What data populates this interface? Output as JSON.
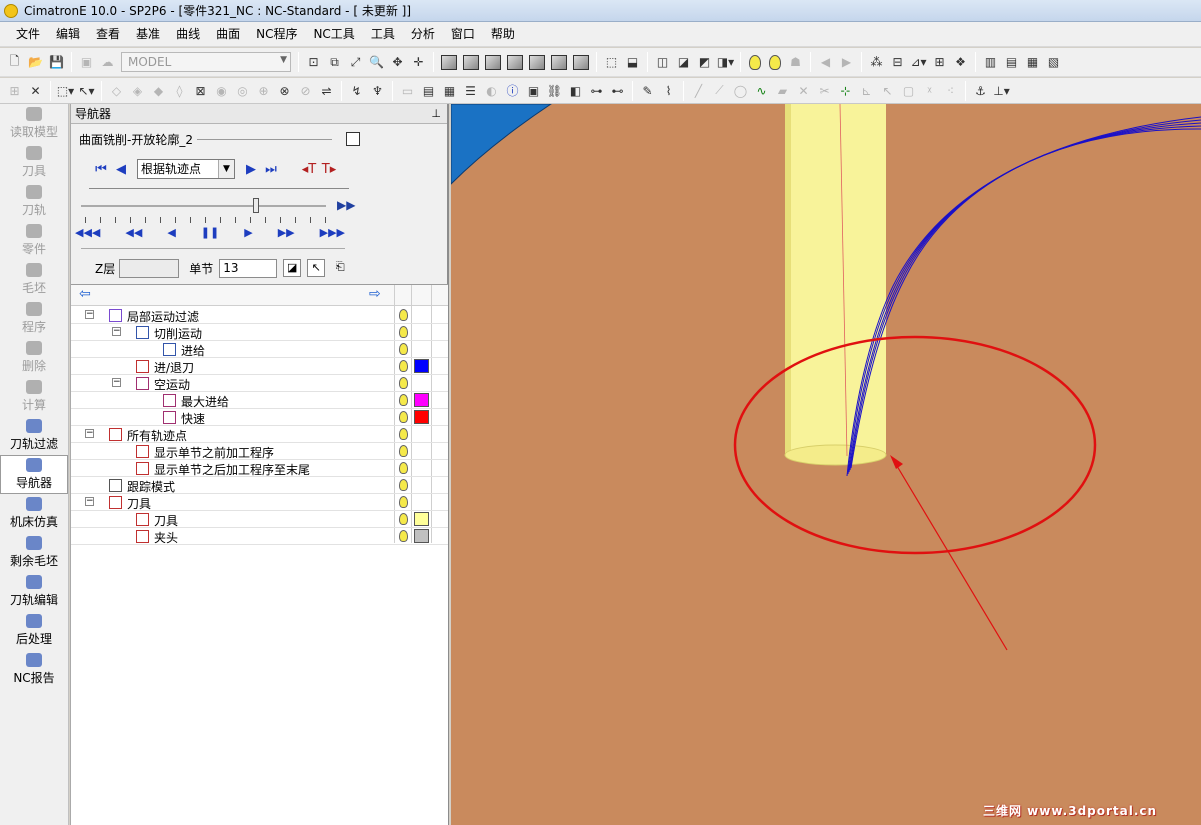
{
  "window": {
    "title": "CimatronE 10.0 - SP2P6 - [零件321_NC : NC-Standard - [ 未更新 ]]"
  },
  "menu": [
    "文件",
    "编辑",
    "查看",
    "基准",
    "曲线",
    "曲面",
    "NC程序",
    "NC工具",
    "工具",
    "分析",
    "窗口",
    "帮助"
  ],
  "toolbar": {
    "model_combo": "MODEL"
  },
  "left_toolbar": [
    {
      "label": "读取模型",
      "enabled": false
    },
    {
      "label": "刀具",
      "enabled": false
    },
    {
      "label": "刀轨",
      "enabled": false
    },
    {
      "label": "零件",
      "enabled": false
    },
    {
      "label": "毛坯",
      "enabled": false
    },
    {
      "label": "程序",
      "enabled": false
    },
    {
      "label": "删除",
      "enabled": false
    },
    {
      "label": "计算",
      "enabled": false
    },
    {
      "label": "刀轨过滤",
      "enabled": true
    },
    {
      "label": "导航器",
      "enabled": true,
      "active": true
    },
    {
      "label": "机床仿真",
      "enabled": true
    },
    {
      "label": "剩余毛坯",
      "enabled": true
    },
    {
      "label": "刀轨编辑",
      "enabled": true
    },
    {
      "label": "后处理",
      "enabled": true
    },
    {
      "label": "NC报告",
      "enabled": true
    }
  ],
  "navigator": {
    "header": "导航器",
    "pin": "ᵍ",
    "procedure": "曲面铣削-开放轮廓_2",
    "mode_combo": "根据轨迹点",
    "z_label": "Z层",
    "z_value": "",
    "step_label": "单节",
    "step_value": "13"
  },
  "tree": [
    {
      "label": "局部运动过滤",
      "level": 0,
      "exp": "-",
      "icon": "filter"
    },
    {
      "label": "切削运动",
      "level": 1,
      "exp": "-",
      "icon": "box"
    },
    {
      "label": "进给",
      "level": 2,
      "exp": "",
      "icon": "box"
    },
    {
      "label": "进/退刀",
      "level": 1,
      "exp": "",
      "icon": "inout",
      "color": "#0000ff"
    },
    {
      "label": "空运动",
      "level": 1,
      "exp": "-",
      "icon": "air"
    },
    {
      "label": "最大进给",
      "level": 2,
      "exp": "",
      "icon": "air",
      "color": "#ff00ff"
    },
    {
      "label": "快速",
      "level": 2,
      "exp": "",
      "icon": "air",
      "color": "#ff0000"
    },
    {
      "label": "所有轨迹点",
      "level": 0,
      "exp": "-",
      "icon": "points"
    },
    {
      "label": "显示单节之前加工程序",
      "level": 1,
      "exp": "",
      "icon": "arrow"
    },
    {
      "label": "显示单节之后加工程序至末尾",
      "level": 1,
      "exp": "",
      "icon": "arrow"
    },
    {
      "label": "跟踪模式",
      "level": 0,
      "exp": "",
      "icon": "trace"
    },
    {
      "label": "刀具",
      "level": 0,
      "exp": "-",
      "icon": "tool"
    },
    {
      "label": "刀具",
      "level": 1,
      "exp": "",
      "icon": "tool",
      "color": "#ffff99"
    },
    {
      "label": "夹头",
      "level": 1,
      "exp": "",
      "icon": "tool",
      "color": "#c0c0c0"
    }
  ],
  "viewport": {
    "background": "#c98a5d",
    "tool_color": "#f8f39a",
    "toolpath_color": "#1a10c8",
    "annotation_color": "#e01010"
  },
  "watermark": "三维网 www.3dportal.cn"
}
